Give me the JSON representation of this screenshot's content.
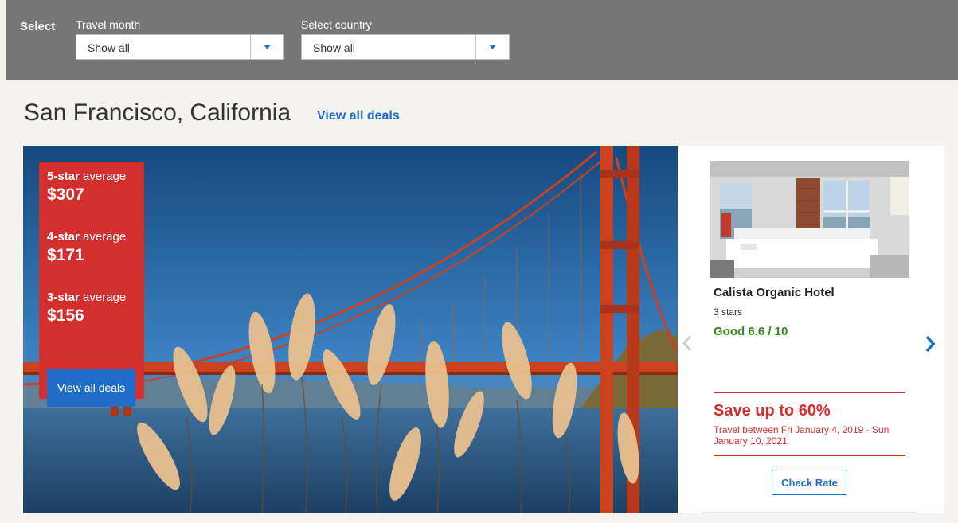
{
  "filters": {
    "title": "Select",
    "month": {
      "label": "Travel month",
      "value": "Show all"
    },
    "country": {
      "label": "Select country",
      "value": "Show all"
    }
  },
  "heading": {
    "city": "San Francisco, California",
    "view_all": "View all deals"
  },
  "averages": [
    {
      "stars": "5-star",
      "suffix": " average",
      "price": "$307"
    },
    {
      "stars": "4-star",
      "suffix": " average",
      "price": "$171"
    },
    {
      "stars": "3-star",
      "suffix": " average",
      "price": "$156"
    }
  ],
  "averages_button": "View all deals",
  "hotel": {
    "name": "Calista Organic Hotel",
    "stars": "3 stars",
    "rating": "Good 6.6 / 10",
    "save": "Save up to 60%",
    "travel": "Travel between Fri January 4, 2019 - Sun January 10, 2021",
    "check_rate": "Check Rate"
  },
  "icons": {
    "dropdown": "caret-down-icon",
    "prev": "chevron-left-icon",
    "next": "chevron-right-icon"
  },
  "colors": {
    "accent_red": "#d32f2f",
    "link_blue": "#1f6dc6",
    "rating_green": "#2e8a19",
    "filter_bar": "#777777"
  }
}
